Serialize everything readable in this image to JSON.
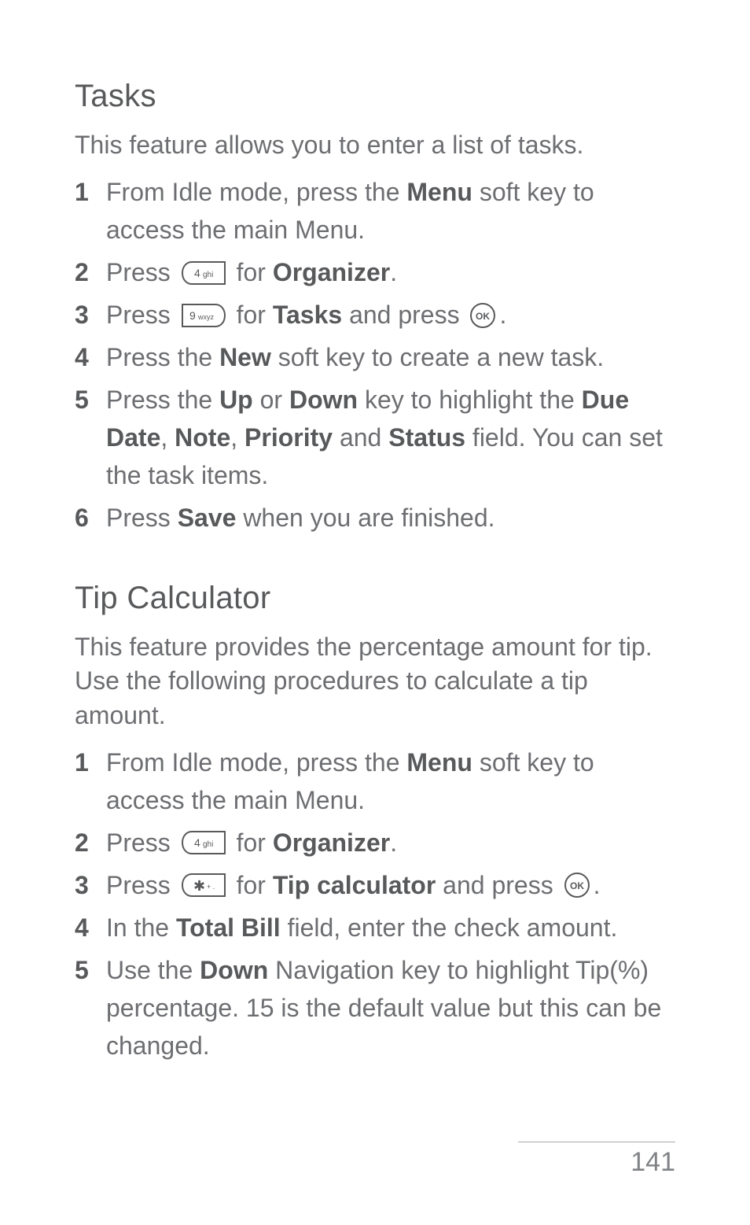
{
  "tasks_section": {
    "heading": "Tasks",
    "intro": "This feature allows you to enter a list of tasks.",
    "steps": [
      {
        "num": "1",
        "pre": "From Idle mode, press the ",
        "bold1": "Menu",
        "post1": " soft key to access the main Menu."
      },
      {
        "num": "2",
        "pre": "Press ",
        "key": "4ghi-left",
        "mid": " for ",
        "bold1": "Organizer",
        "post1": "."
      },
      {
        "num": "3",
        "pre": "Press ",
        "key": "9wxyz-right",
        "mid": " for ",
        "bold1": "Tasks",
        "post1": " and press ",
        "key2": "ok",
        "post2": "."
      },
      {
        "num": "4",
        "pre": "Press the ",
        "bold1": "New",
        "post1": " soft key to create a new task."
      },
      {
        "num": "5",
        "pre": "Press the ",
        "bold1": "Up",
        "mid": " or ",
        "bold2": "Down",
        "post1": " key to highlight the ",
        "bold3": "Due Date",
        "sep1": ", ",
        "bold4": "Note",
        "sep2": ", ",
        "bold5": "Priority",
        "sep3": " and ",
        "bold6": "Status",
        "post2": " field. You can set the task items."
      },
      {
        "num": "6",
        "pre": "Press ",
        "bold1": "Save",
        "post1": " when you are finished."
      }
    ]
  },
  "tip_section": {
    "heading": "Tip Calculator",
    "intro": "This feature provides the percentage amount for tip. Use the following procedures to calculate a tip amount.",
    "steps": [
      {
        "num": "1",
        "pre": "From Idle mode, press the ",
        "bold1": "Menu",
        "post1": " soft key to access the main Menu."
      },
      {
        "num": "2",
        "pre": "Press ",
        "key": "4ghi-left",
        "mid": " for ",
        "bold1": "Organizer",
        "post1": "."
      },
      {
        "num": "3",
        "pre": "Press ",
        "key": "star-left",
        "mid": " for ",
        "bold1": "Tip calculator",
        "post1": " and press ",
        "key2": "ok",
        "post2": "."
      },
      {
        "num": "4",
        "pre": "In the ",
        "bold1": "Total Bill",
        "post1": " field, enter the check amount."
      },
      {
        "num": "5",
        "pre": "Use the ",
        "bold1": "Down",
        "post1": " Navigation key to highlight Tip(%) percentage. 15 is the default value but this can be changed."
      }
    ]
  },
  "page_number": "141"
}
